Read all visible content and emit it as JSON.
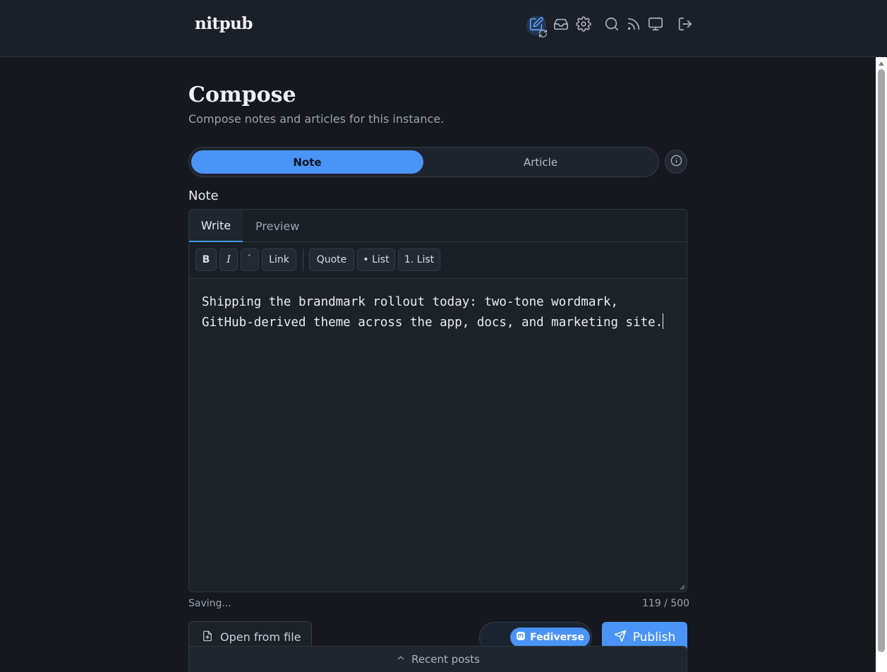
{
  "app": {
    "brand": "nitpub",
    "accent_color": "#4a94f7",
    "nav_icons": [
      "compose-icon",
      "inbox-icon",
      "gear-icon",
      "search-icon",
      "rss-icon",
      "monitor-icon",
      "logout-icon"
    ]
  },
  "page": {
    "title": "Compose",
    "subtitle": "Compose notes and articles for this instance."
  },
  "mode_toggle": {
    "options": [
      "Note",
      "Article"
    ],
    "selected": "Note"
  },
  "editor": {
    "label": "Note",
    "tabs": [
      "Write",
      "Preview"
    ],
    "active_tab": "Write",
    "toolbar": {
      "bold": "B",
      "italic": "I",
      "code": "`",
      "link": "Link",
      "quote": "Quote",
      "bullet_list": "• List",
      "numbered_list": "1. List"
    },
    "content": "Shipping the brandmark rollout today: two-tone wordmark,\nGitHub-derived theme across the app, docs, and marketing site."
  },
  "status": {
    "save_state": "Saving...",
    "char_count": "119 / 500"
  },
  "actions": {
    "open_file": "Open from file",
    "fediverse": "Fediverse",
    "publish": "Publish",
    "recent_posts": "Recent posts"
  }
}
